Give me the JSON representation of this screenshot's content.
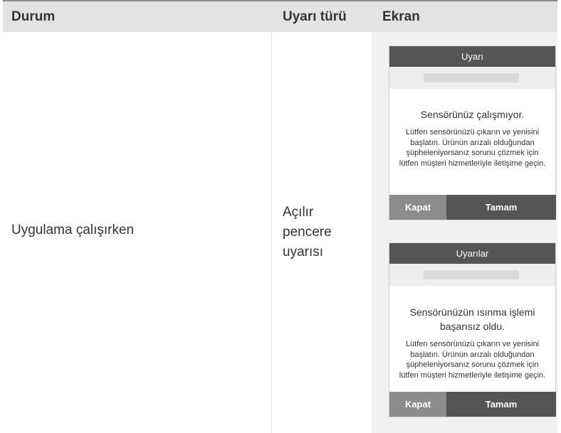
{
  "table": {
    "headers": [
      "Durum",
      "Uyarı türü",
      "Ekran"
    ],
    "row": {
      "durum": "Uygulama çalışırken",
      "uyari_turu": [
        "Açılır",
        "pencere",
        "uyarısı"
      ]
    }
  },
  "screens": [
    {
      "title": "Uyarı",
      "headline": "Sensörünüz çalışmıyor.",
      "message": "Lütfen sensörünüzü çıkarın ve yenisini başlatın. Ürünün arızalı olduğundan şüpheleniyorsanız sorunu çözmek için lütfen müşteri hizmetleriyle iletişime geçin.",
      "close_label": "Kapat",
      "ok_label": "Tamam"
    },
    {
      "title": "Uyarılar",
      "headline": "Sensörünüzün ısınma işlemi başarısız oldu.",
      "message": "Lütfen sensörünüzü çıkarın ve yenisini başlatın. Ürünün arızalı olduğundan şüpheleniyorsanız sorunu çözmek için lütfen müşteri hizmetleriyle iletişime geçin.",
      "close_label": "Kapat",
      "ok_label": "Tamam"
    }
  ],
  "colors": {
    "header_bg": "#e3e3e3",
    "screen_col_bg": "#f1f1f1",
    "titlebar_bg": "#555555",
    "close_button_bg": "#8c8c8c",
    "ok_button_bg": "#555555"
  }
}
